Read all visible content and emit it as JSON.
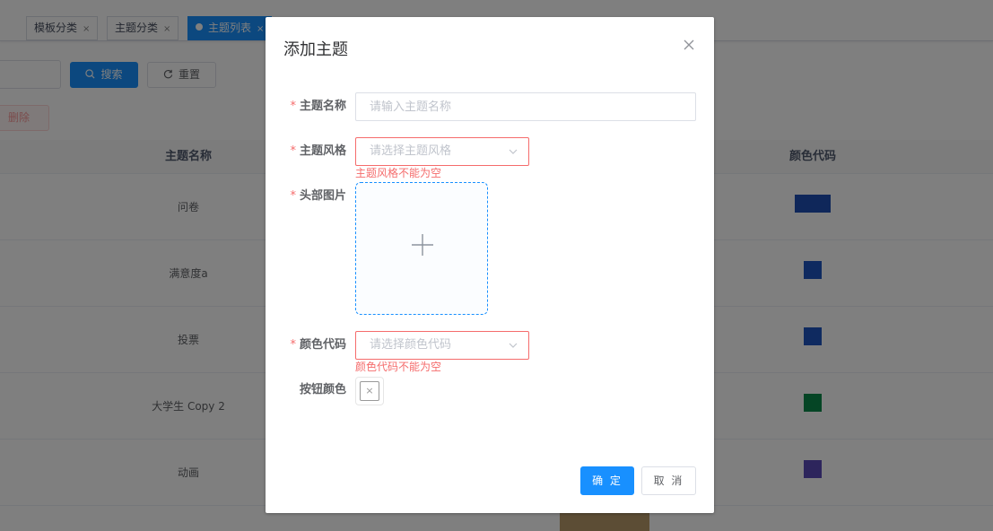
{
  "tabs": [
    {
      "label": "",
      "close": "×"
    },
    {
      "label": "模板分类",
      "close": "×"
    },
    {
      "label": "主题分类",
      "close": "×"
    },
    {
      "label": "主题列表",
      "close": "×",
      "active": true
    }
  ],
  "toolbar": {
    "search_label": "搜索",
    "reset_label": "重置",
    "delete_label": "删除"
  },
  "table": {
    "headers": {
      "name": "主题名称",
      "color": "颜色代码"
    },
    "rows": [
      {
        "name": "问卷",
        "color": "#1f4fb5"
      },
      {
        "name": "满意度a",
        "color": "#1f55c0"
      },
      {
        "name": "投票",
        "color": "#1f55c0"
      },
      {
        "name": "大学生 Copy 2",
        "color": "#0a8a4a"
      },
      {
        "name": "动画",
        "color": "#5a4ab8"
      }
    ]
  },
  "dialog": {
    "title": "添加主题",
    "close_symbol": "×",
    "fields": {
      "name": {
        "label": "主题名称",
        "required": "*",
        "placeholder": "请输入主题名称"
      },
      "style": {
        "label": "主题风格",
        "required": "*",
        "placeholder": "请选择主题风格",
        "error": "主题风格不能为空"
      },
      "image": {
        "label": "头部图片",
        "required": "*"
      },
      "color": {
        "label": "颜色代码",
        "required": "*",
        "placeholder": "请选择颜色代码",
        "error": "颜色代码不能为空"
      },
      "button_color": {
        "label": "按钮颜色",
        "value_symbol": "×"
      }
    },
    "confirm_label": "确 定",
    "cancel_label": "取 消"
  },
  "colors": {
    "primary": "#1890ff",
    "error": "#f56c6c"
  }
}
